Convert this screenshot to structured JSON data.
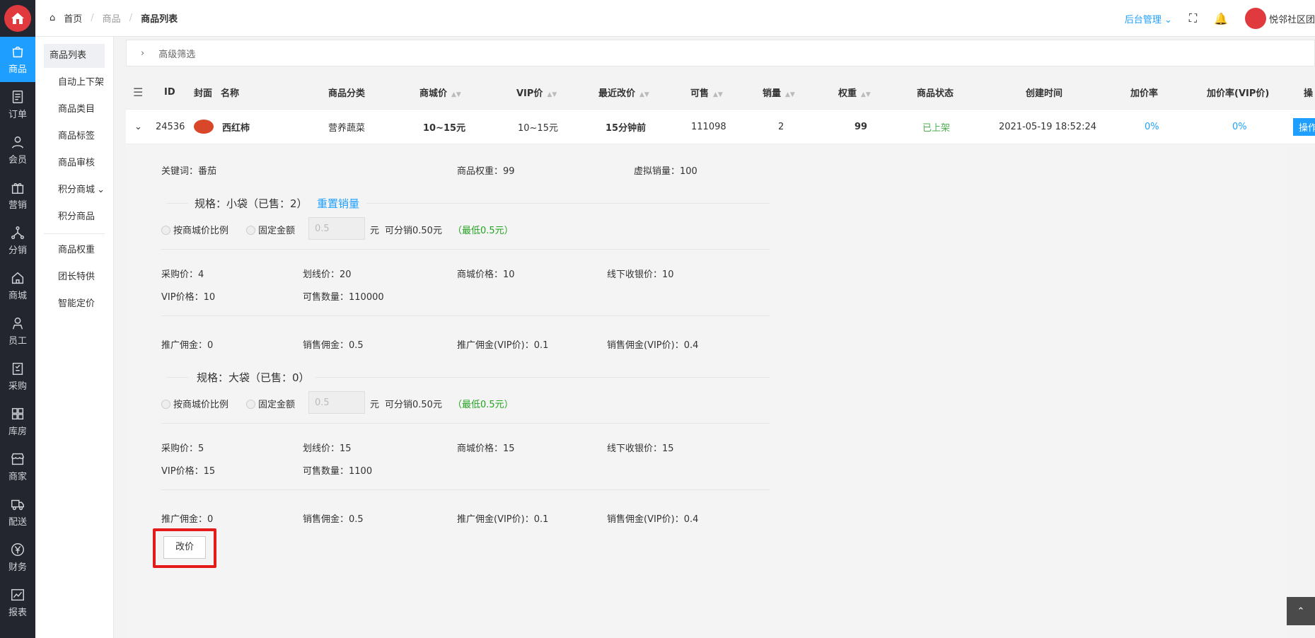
{
  "breadcrumb": {
    "home": "首页",
    "goods": "商品",
    "current": "商品列表"
  },
  "topbar": {
    "admin": "后台管理",
    "user": "悦邻社区团"
  },
  "nav": [
    {
      "label": "商品",
      "icon": "bag-icon"
    },
    {
      "label": "订单",
      "icon": "order-icon"
    },
    {
      "label": "会员",
      "icon": "user-icon"
    },
    {
      "label": "营销",
      "icon": "gift-icon"
    },
    {
      "label": "分销",
      "icon": "share-icon"
    },
    {
      "label": "商城",
      "icon": "home-icon"
    },
    {
      "label": "员工",
      "icon": "staff-icon"
    },
    {
      "label": "采购",
      "icon": "clipboard-icon"
    },
    {
      "label": "库房",
      "icon": "grid-icon"
    },
    {
      "label": "商家",
      "icon": "store-icon"
    },
    {
      "label": "配送",
      "icon": "truck-icon"
    },
    {
      "label": "财务",
      "icon": "yen-icon"
    },
    {
      "label": "报表",
      "icon": "chart-icon"
    }
  ],
  "submenu": [
    "商品列表",
    "自动上下架",
    "商品类目",
    "商品标签",
    "商品审核",
    "积分商城",
    "积分商品",
    "商品权重",
    "团长特供",
    "智能定价"
  ],
  "filter": "高级筛选",
  "headers": [
    "ID",
    "封面",
    "名称",
    "商品分类",
    "商城价",
    "VIP价",
    "最近改价",
    "可售",
    "销量",
    "权重",
    "商品状态",
    "创建时间",
    "加价率",
    "加价率(VIP价)",
    "操"
  ],
  "row": {
    "id": "24536",
    "name": "西红柿",
    "category": "营养蔬菜",
    "price": "10~15元",
    "vip_price": "10~15元",
    "last_change": "15分钟前",
    "available": "111098",
    "sales": "2",
    "weight": "99",
    "status": "已上架",
    "created": "2021-05-19 18:52:24",
    "markup": "0%",
    "markup_vip": "0%",
    "action": "操作"
  },
  "detail": {
    "keyword_label": "关键词：",
    "keyword": "番茄",
    "weight_label": "商品权重：",
    "weight": "99",
    "virtual_label": "虚拟销量：",
    "virtual": "100",
    "specs": [
      {
        "title": "规格：小袋（已售：2）",
        "reset": "重置销量",
        "opt1": "按商城价比例",
        "opt2": "固定金额",
        "input": "0.5",
        "yuan": "元",
        "dist": "可分销0.50元",
        "min": "（最低0.5元）",
        "purchase": "采购价：",
        "purchase_v": "4",
        "line": "划线价：",
        "line_v": "20",
        "mall": "商城价格：",
        "mall_v": "10",
        "offline": "线下收银价：",
        "offline_v": "10",
        "vip": "VIP价格：",
        "vip_v": "10",
        "stock": "可售数量：",
        "stock_v": "110000",
        "promo": "推广佣金：",
        "promo_v": "0",
        "sale": "销售佣金：",
        "sale_v": "0.5",
        "promo_vip": "推广佣金(VIP价)：",
        "promo_vip_v": "0.1",
        "sale_vip": "销售佣金(VIP价)：",
        "sale_vip_v": "0.4"
      },
      {
        "title": "规格：大袋（已售：0）",
        "reset": "",
        "opt1": "按商城价比例",
        "opt2": "固定金额",
        "input": "0.5",
        "yuan": "元",
        "dist": "可分销0.50元",
        "min": "（最低0.5元）",
        "purchase": "采购价：",
        "purchase_v": "5",
        "line": "划线价：",
        "line_v": "15",
        "mall": "商城价格：",
        "mall_v": "15",
        "offline": "线下收银价：",
        "offline_v": "15",
        "vip": "VIP价格：",
        "vip_v": "15",
        "stock": "可售数量：",
        "stock_v": "1100",
        "promo": "推广佣金：",
        "promo_v": "0",
        "sale": "销售佣金：",
        "sale_v": "0.5",
        "promo_vip": "推广佣金(VIP价)：",
        "promo_vip_v": "0.1",
        "sale_vip": "销售佣金(VIP价)：",
        "sale_vip_v": "0.4"
      }
    ],
    "button": "改价"
  }
}
